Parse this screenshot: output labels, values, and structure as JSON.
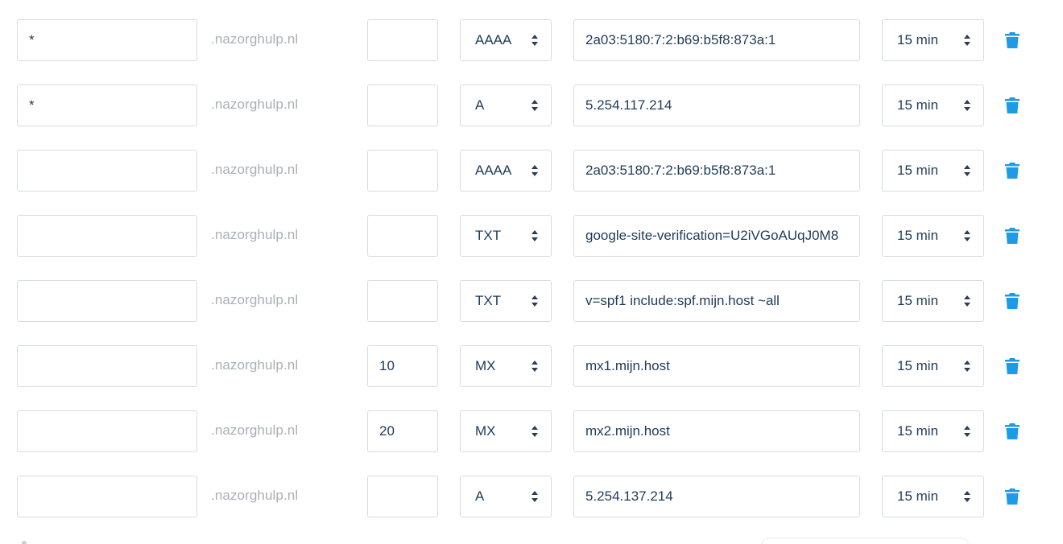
{
  "domain_suffix": ".nazorghulp.nl",
  "colors": {
    "accent": "#1e9be6",
    "text": "#1f3b57",
    "muted": "#a9b0b8",
    "border": "#d7dbe0"
  },
  "icons": {
    "select": "sort-arrows-icon",
    "delete": "trash-icon"
  },
  "records": [
    {
      "name": "*",
      "priority": "",
      "type": "AAAA",
      "value": "2a03:5180:7:2:b69:b5f8:873a:1",
      "ttl": "15 min"
    },
    {
      "name": "*",
      "priority": "",
      "type": "A",
      "value": "5.254.117.214",
      "ttl": "15 min"
    },
    {
      "name": "",
      "priority": "",
      "type": "AAAA",
      "value": "2a03:5180:7:2:b69:b5f8:873a:1",
      "ttl": "15 min"
    },
    {
      "name": "",
      "priority": "",
      "type": "TXT",
      "value": "google-site-verification=U2iVGoAUqJ0M8",
      "ttl": "15 min"
    },
    {
      "name": "",
      "priority": "",
      "type": "TXT",
      "value": "v=spf1 include:spf.mijn.host ~all",
      "ttl": "15 min"
    },
    {
      "name": "",
      "priority": "10",
      "type": "MX",
      "value": "mx1.mijn.host",
      "ttl": "15 min"
    },
    {
      "name": "",
      "priority": "20",
      "type": "MX",
      "value": "mx2.mijn.host",
      "ttl": "15 min"
    },
    {
      "name": "",
      "priority": "",
      "type": "A",
      "value": "5.254.137.214",
      "ttl": "15 min"
    }
  ]
}
